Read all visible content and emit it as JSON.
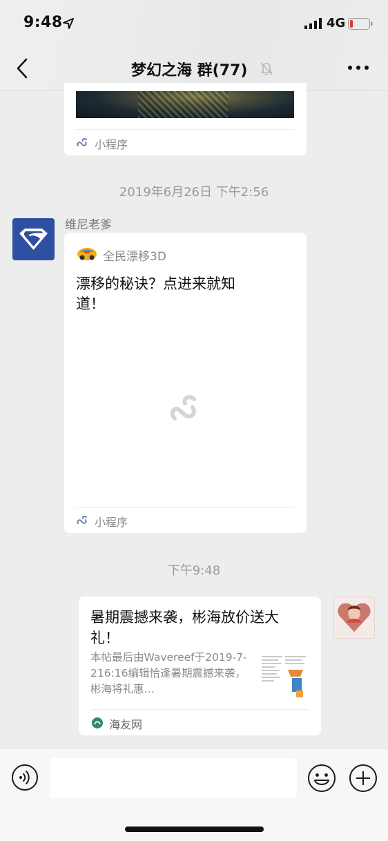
{
  "status_bar": {
    "time": "9:48",
    "network": "4G"
  },
  "nav": {
    "title": "梦幻之海 群(77)"
  },
  "messages": {
    "card1": {
      "footer_label": "小程序"
    },
    "timestamp1": "2019年6月26日 下午2:56",
    "sender_name": "维尼老爹",
    "card2": {
      "app_name": "全民漂移3D",
      "title": "漂移的秘诀？点进来就知道！",
      "footer_label": "小程序"
    },
    "timestamp2": "下午9:48",
    "card3": {
      "title": "暑期震撼来袭，彬海放价送大礼！",
      "description": "本帖最后由Wavereef于2019-7-216:16编辑恰逢暑期震撼来袭，彬海将礼惠…",
      "source": "海友网"
    }
  },
  "input": {
    "placeholder": ""
  },
  "colors": {
    "background": "#ededed",
    "card": "#ffffff",
    "muted_text": "#9a9a9a",
    "avatar_blue": "#2f4fa2"
  }
}
